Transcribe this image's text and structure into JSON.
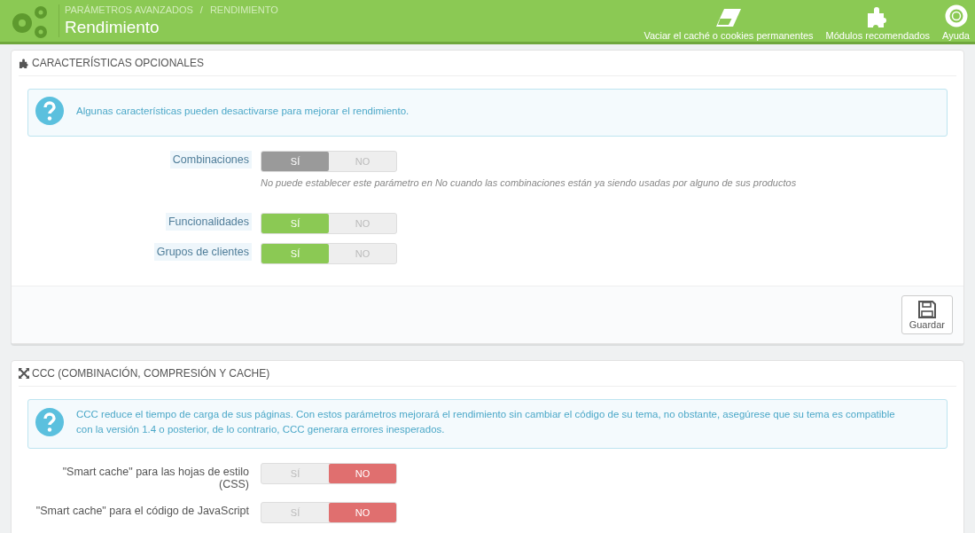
{
  "header": {
    "breadcrumb": [
      "PARÁMETROS AVANZADOS",
      "RENDIMIENTO"
    ],
    "separator": "/",
    "title": "Rendimiento",
    "actions": [
      {
        "kind": "eraser",
        "label": "Vaciar el caché o cookies permanentes"
      },
      {
        "kind": "puzzle",
        "label": "Módulos recomendados"
      },
      {
        "kind": "lifebuoy",
        "label": "Ayuda"
      }
    ]
  },
  "panels": [
    {
      "kind": "features",
      "title": "CARACTERÍSTICAS OPCIONALES",
      "alert": [
        "Algunas características pueden desactivarse para mejorar el rendimiento."
      ],
      "rows": [
        {
          "label": "Combinaciones",
          "disabled": true,
          "options": [
            {
              "label": "SÍ",
              "selected": true
            },
            {
              "label": "NO",
              "selected": false
            }
          ],
          "help": "No puede establecer este parámetro en No cuando las combinaciones están ya siendo usadas por alguno de sus productos"
        },
        {
          "label": "Funcionalidades",
          "disabled": false,
          "options": [
            {
              "label": "SÍ",
              "selected": true
            },
            {
              "label": "NO",
              "selected": false
            }
          ]
        },
        {
          "label": "Grupos de clientes",
          "disabled": false,
          "options": [
            {
              "label": "SÍ",
              "selected": true
            },
            {
              "label": "NO",
              "selected": false
            }
          ]
        }
      ],
      "save": "Guardar"
    },
    {
      "kind": "ccc",
      "title": "CCC (COMBINACIÓN, COMPRESIÓN Y CACHE)",
      "alert": [
        "CCC reduce el tiempo de carga de sus páginas. Con estos parámetros mejorará el rendimiento sin cambiar el código de su tema, no obstante, asegúrese que su tema es compatible",
        "con la versión 1.4 o posterior, de lo contrario, CCC generara errores inesperados."
      ],
      "rows": [
        {
          "label": "\"Smart cache\" para las hojas de estilo (CSS)",
          "disabled": false,
          "options": [
            {
              "label": "SÍ",
              "selected": false
            },
            {
              "label": "NO",
              "selected": true
            }
          ]
        },
        {
          "label": "\"Smart cache\" para el código de JavaScript",
          "disabled": false,
          "options": [
            {
              "label": "SÍ",
              "selected": false
            },
            {
              "label": "NO",
              "selected": true
            }
          ]
        }
      ]
    }
  ]
}
